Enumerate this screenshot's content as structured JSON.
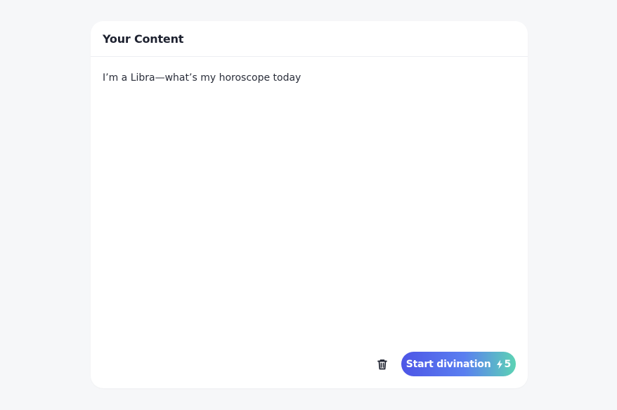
{
  "panel": {
    "title": "Your Content",
    "content": "I’m a Libra—what’s my horoscope today"
  },
  "actions": {
    "clear_icon": "trash-icon",
    "start_label": "Start divination",
    "cost_icon": "lightning-icon",
    "cost": "5"
  },
  "colors": {
    "background": "#f6f7f9",
    "gradient_start": "#4d55e6",
    "gradient_end": "#5cd3b4"
  }
}
